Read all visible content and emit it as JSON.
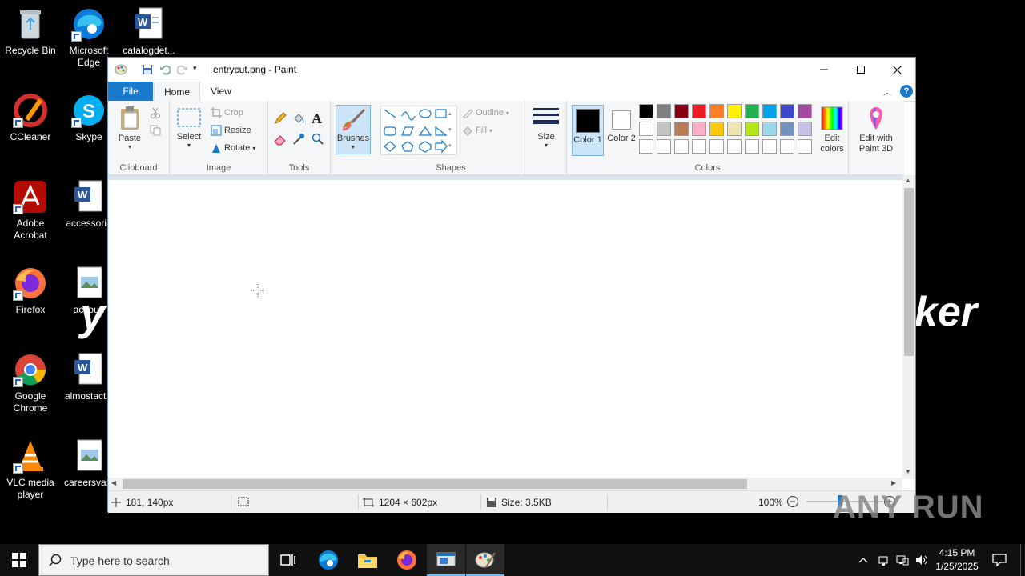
{
  "desktop": {
    "icons": [
      {
        "label": "Recycle Bin"
      },
      {
        "label": "Microsoft Edge"
      },
      {
        "label": "catalogdet..."
      },
      {
        "label": "CCleaner"
      },
      {
        "label": "Skype"
      },
      {
        "label": "Adobe Acrobat"
      },
      {
        "label": "accessorie"
      },
      {
        "label": "Firefox"
      },
      {
        "label": "accoun"
      },
      {
        "label": "Google Chrome"
      },
      {
        "label": "almostactiv"
      },
      {
        "label": "VLC media player"
      },
      {
        "label": "careersvalu"
      }
    ],
    "wallpaper_left": "y",
    "wallpaper_right": "ker"
  },
  "paint": {
    "title": "entrycut.png - Paint",
    "tabs": {
      "file": "File",
      "home": "Home",
      "view": "View"
    },
    "clipboard": {
      "paste": "Paste",
      "group": "Clipboard"
    },
    "image": {
      "select": "Select",
      "crop": "Crop",
      "resize": "Resize",
      "rotate": "Rotate",
      "group": "Image"
    },
    "tools": {
      "group": "Tools"
    },
    "brushes": {
      "label": "Brushes"
    },
    "shapes": {
      "outline": "Outline",
      "fill": "Fill",
      "group": "Shapes"
    },
    "size": {
      "label": "Size"
    },
    "colors": {
      "color1": "Color 1",
      "color2": "Color 2",
      "edit": "Edit colors",
      "group": "Colors",
      "palette_row1": [
        "#000000",
        "#7f7f7f",
        "#880015",
        "#ed1c24",
        "#ff7f27",
        "#fff200",
        "#22b14c",
        "#00a2e8",
        "#3f48cc",
        "#a349a4"
      ],
      "palette_row2": [
        "#ffffff",
        "#c3c3c3",
        "#b97a57",
        "#ffaec9",
        "#ffc90e",
        "#efe4b0",
        "#b5e61d",
        "#99d9ea",
        "#7092be",
        "#c8bfe7"
      ],
      "palette_row3": [
        "#ffffff",
        "#ffffff",
        "#ffffff",
        "#ffffff",
        "#ffffff",
        "#ffffff",
        "#ffffff",
        "#ffffff",
        "#ffffff",
        "#ffffff"
      ]
    },
    "paint3d": "Edit with Paint 3D",
    "status": {
      "cursor_pos": "181, 140px",
      "dimensions": "1204 × 602px",
      "size": "Size: 3.5KB",
      "zoom": "100%"
    }
  },
  "taskbar": {
    "search_placeholder": "Type here to search",
    "time": "4:15 PM",
    "date": "1/25/2025"
  },
  "watermark": "ANY RUN"
}
